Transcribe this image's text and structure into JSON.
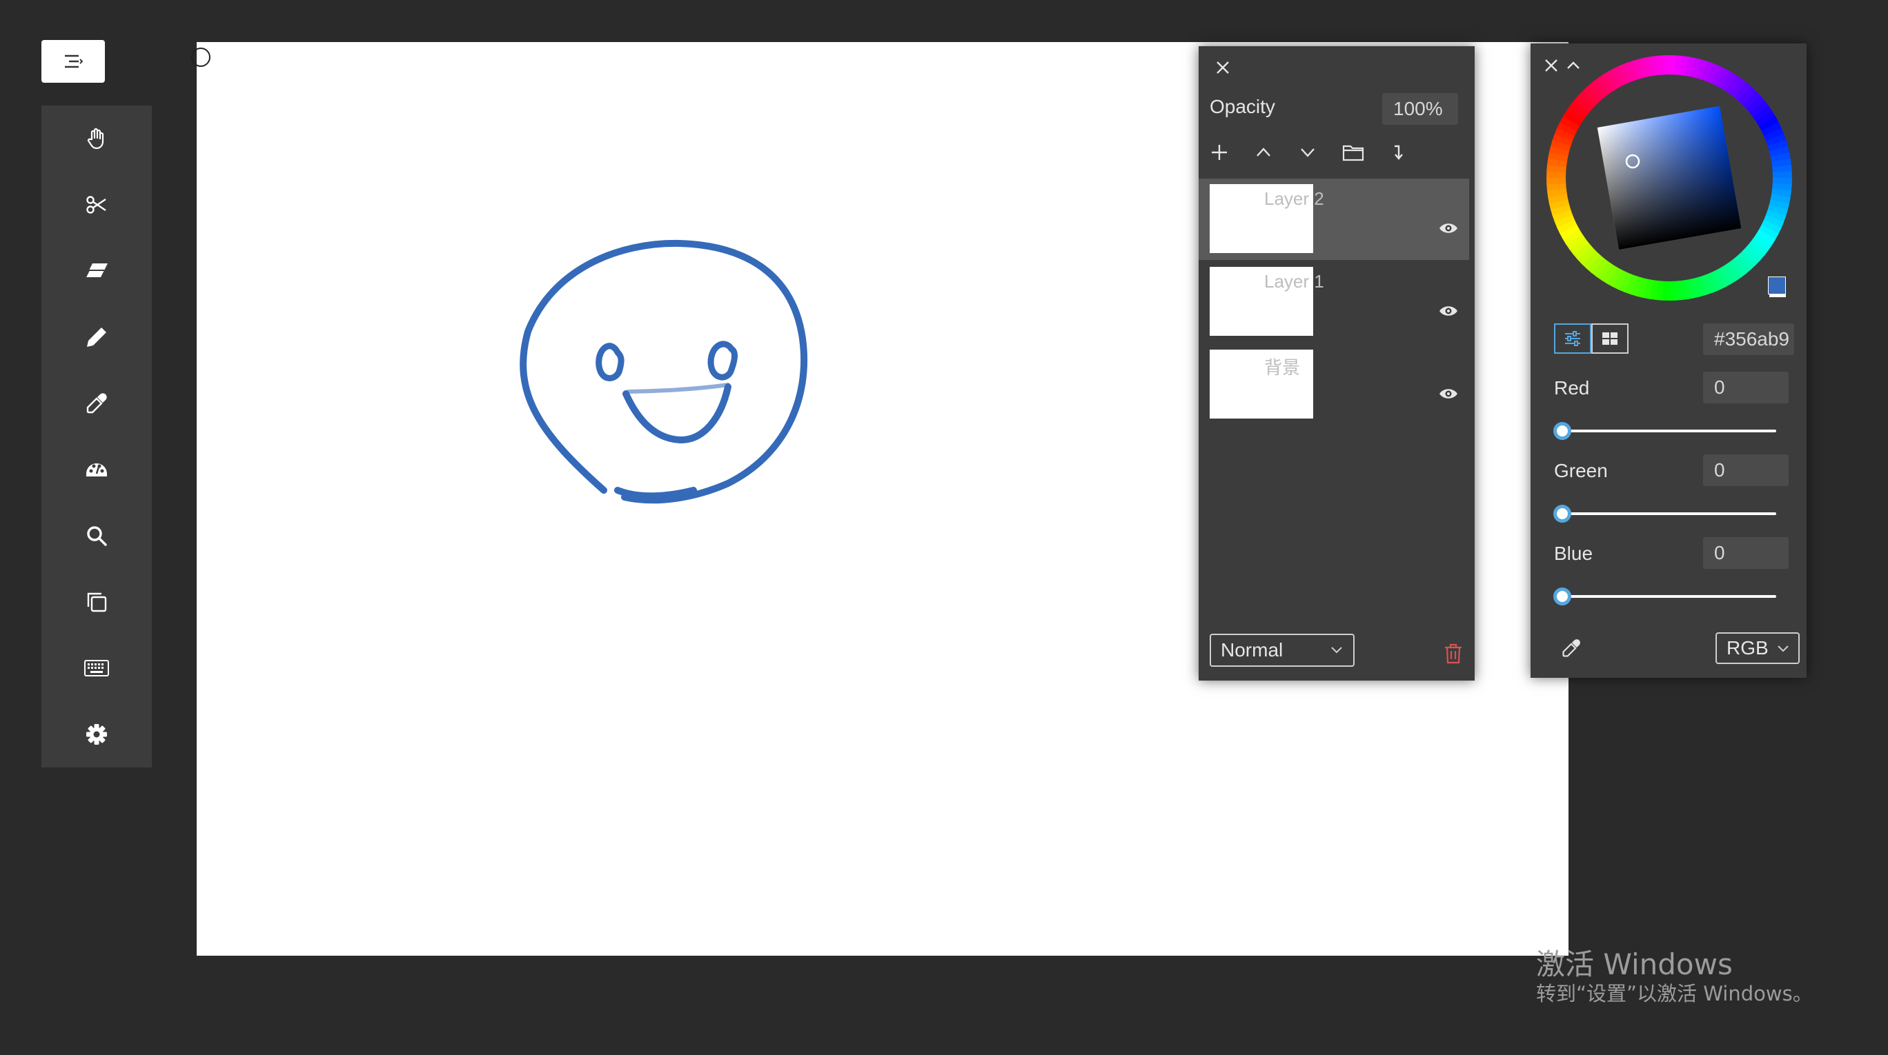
{
  "menu": {
    "icon": "menu-collapse-icon"
  },
  "toolbar": {
    "tools": [
      {
        "name": "hand-icon"
      },
      {
        "name": "scissors-icon"
      },
      {
        "name": "eraser-icon"
      },
      {
        "name": "brush-icon"
      },
      {
        "name": "eyedropper-icon"
      },
      {
        "name": "palette-icon"
      },
      {
        "name": "search-icon"
      },
      {
        "name": "copy-icon"
      },
      {
        "name": "keyboard-icon"
      },
      {
        "name": "settings-icon"
      }
    ],
    "active_tool": "brush-icon"
  },
  "layers_panel": {
    "opacity_label": "Opacity",
    "opacity_value": "100%",
    "layers": [
      {
        "name": "Layer 2",
        "selected": true
      },
      {
        "name": "Layer 1",
        "selected": false
      },
      {
        "name": "背景",
        "selected": false
      }
    ],
    "blend_mode": "Normal",
    "colors": {
      "selected_row": "#5a5a5a",
      "delete": "#d9534f"
    }
  },
  "color_panel": {
    "hex": "#356ab9",
    "channels": [
      {
        "label": "Red",
        "value": "0",
        "level": 0
      },
      {
        "label": "Green",
        "value": "0",
        "level": 0
      },
      {
        "label": "Blue",
        "value": "0",
        "level": 0
      }
    ],
    "mode": "RGB",
    "colors": {
      "primary": "#356ab9",
      "secondary": "#ffffff",
      "accent": "#56a7de"
    }
  },
  "watermark": {
    "title": "激活 Windows",
    "subtitle": "转到“设置”以激活 Windows。"
  }
}
